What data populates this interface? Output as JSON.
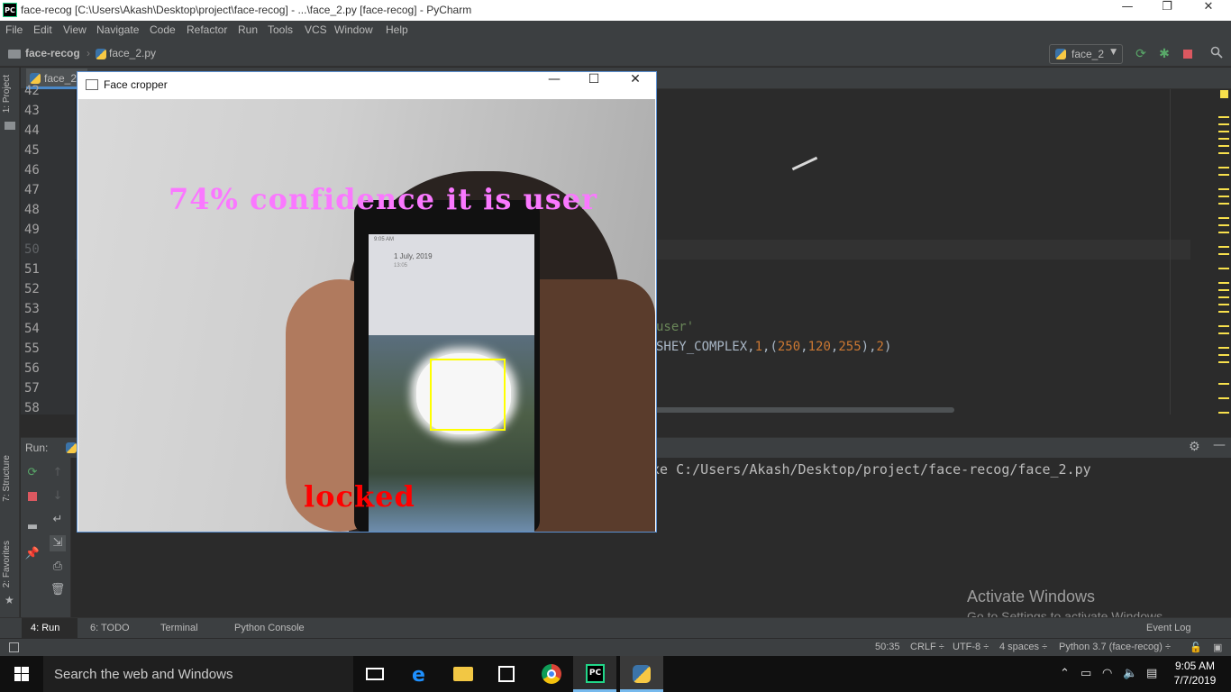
{
  "titlebar": {
    "app_icon": "PC",
    "title": "face-recog [C:\\Users\\Akash\\Desktop\\project\\face-recog] - ...\\face_2.py [face-recog] - PyCharm",
    "minimize": "—",
    "restore": "❐",
    "close": "✕"
  },
  "menu": [
    "File",
    "Edit",
    "View",
    "Navigate",
    "Code",
    "Refactor",
    "Run",
    "Tools",
    "VCS",
    "Window",
    "Help"
  ],
  "navbar": {
    "project": "face-recog",
    "file": "face_2.py",
    "run_config": "face_2"
  },
  "editor": {
    "tab_label": "face_2.",
    "line_numbers": [
      "42",
      "43",
      "44",
      "45",
      "46",
      "47",
      "48",
      "49",
      "50",
      "51",
      "52",
      "53",
      "54",
      "55",
      "56",
      "57",
      "58"
    ],
    "line54_str": "user'",
    "line55_prefix": "SHEY_COMPLEX,",
    "line55_n1": "1",
    "line55_c1": ",(",
    "line55_n2": "250",
    "line55_c2": ",",
    "line55_n3": "120",
    "line55_c3": ",",
    "line55_n4": "255",
    "line55_c4": "),",
    "line55_n5": "2",
    "line55_c5": ")"
  },
  "left_tabs": {
    "project": "1: Project",
    "structure": "7: Structure",
    "favorites": "2: Favorites"
  },
  "run_panel": {
    "label": "Run:",
    "console_line": "xe C:/Users/Akash/Desktop/project/face-recog/face_2.py"
  },
  "watermark": {
    "line1": "Activate Windows",
    "line2": "Go to Settings to activate Windows."
  },
  "bottom_tabs": {
    "run": "4: Run",
    "todo": "6: TODO",
    "terminal": "Terminal",
    "python_console": "Python Console",
    "event_log": "Event Log"
  },
  "status": {
    "position": "50:35",
    "line_sep": "CRLF ÷",
    "encoding": "UTF-8 ÷",
    "indent": "4 spaces ÷",
    "interpreter": "Python 3.7 (face-recog) ÷"
  },
  "face_window": {
    "title": "Face cropper",
    "minimize": "—",
    "maximize": "☐",
    "close": "✕",
    "confidence_text": "74% confidence it is user",
    "lock_text": "locked",
    "phone_time": "9:05 AM",
    "phone_date": "1 July, 2019",
    "phone_sub": "13:05"
  },
  "taskbar": {
    "search_placeholder": "Search the web and Windows",
    "time": "9:05 AM",
    "date": "7/7/2019"
  },
  "colors": {
    "accent": "#4a88c7",
    "confidence_text": "#fa78ff",
    "locked_text": "#ff0000",
    "face_box": "#ffff00"
  }
}
